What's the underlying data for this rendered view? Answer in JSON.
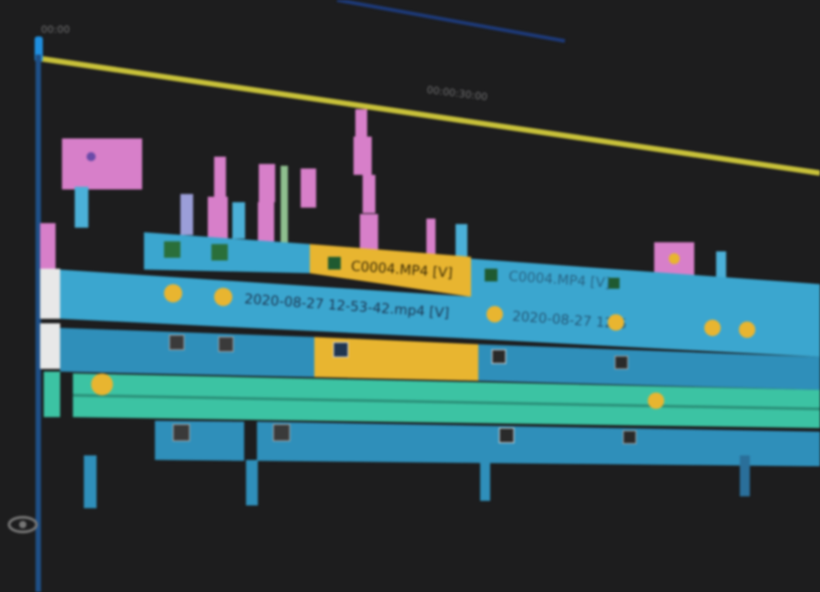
{
  "timeline": {
    "ruler_timecode": "00:00:30:00",
    "start_label": "00:00"
  },
  "clips": {
    "video2_selected": "C0004.MP4 [V]",
    "video1_main": "2020-08-27 12-53-42.mp4 [V]",
    "video1_next": "2020-08-27 12-5",
    "video2_next": "C0004.MP4 [V]"
  },
  "colors": {
    "background": "#1d1d1e",
    "playhead": "#1f7fd0",
    "work_area": "#c9c23a",
    "video_clip": "#3ba6cf",
    "selected_clip": "#e8b530",
    "audio_green": "#3cc3a3",
    "marker_pink": "#d77fc9"
  },
  "icons": [
    "eye-icon",
    "fx-badge-icon",
    "playhead-marker-icon",
    "keyframe-icon"
  ]
}
